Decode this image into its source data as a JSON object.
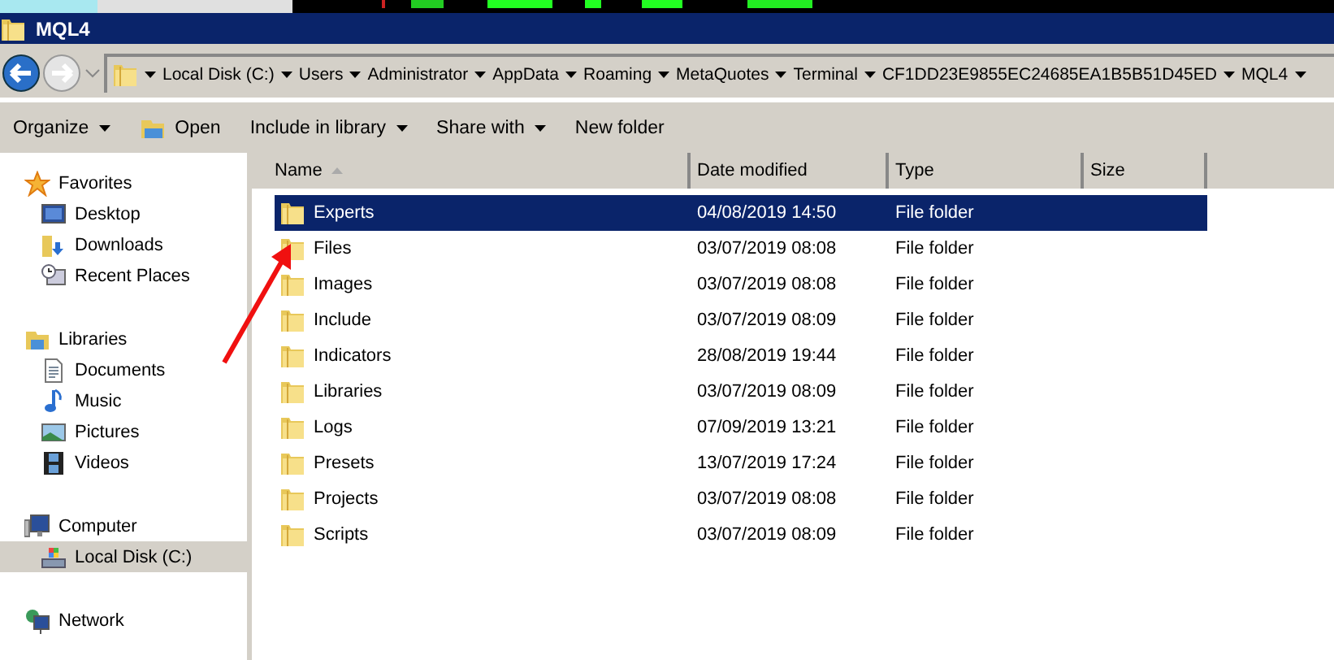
{
  "window": {
    "title": "MQL4"
  },
  "address_bar": {
    "segments": [
      "Local Disk (C:)",
      "Users",
      "Administrator",
      "AppData",
      "Roaming",
      "MetaQuotes",
      "Terminal",
      "CF1DD23E9855EC24685EA1B5B51D45ED",
      "MQL4"
    ]
  },
  "toolbar": [
    {
      "label": "Organize",
      "kind": "menu"
    },
    {
      "label": "Open",
      "kind": "icon"
    },
    {
      "label": "Include in library",
      "kind": "menu"
    },
    {
      "label": "Share with",
      "kind": "menu"
    },
    {
      "label": "New folder",
      "kind": "plain"
    }
  ],
  "sidebar": {
    "items": [
      {
        "label": "Favorites",
        "kind": "star",
        "selected": false,
        "children": [
          {
            "label": "Desktop",
            "kind": "desktop",
            "selected": false
          },
          {
            "label": "Downloads",
            "kind": "downloads",
            "selected": false
          },
          {
            "label": "Recent Places",
            "kind": "recent",
            "selected": false
          }
        ]
      },
      {
        "label": "Libraries",
        "kind": "libraries",
        "selected": false,
        "children": [
          {
            "label": "Documents",
            "kind": "document",
            "selected": false
          },
          {
            "label": "Music",
            "kind": "music",
            "selected": false
          },
          {
            "label": "Pictures",
            "kind": "pictures",
            "selected": false
          },
          {
            "label": "Videos",
            "kind": "videos",
            "selected": false
          }
        ]
      },
      {
        "label": "Computer",
        "kind": "computer",
        "selected": false,
        "children": [
          {
            "label": "Local Disk (C:)",
            "kind": "disk",
            "selected": true
          }
        ]
      },
      {
        "label": "Network",
        "kind": "network",
        "selected": false
      }
    ]
  },
  "table": {
    "columns": [
      {
        "label": "Name",
        "sorted": true
      },
      {
        "label": "Date modified",
        "sorted": false
      },
      {
        "label": "Type",
        "sorted": false
      },
      {
        "label": "Size",
        "sorted": false
      }
    ],
    "rows": [
      {
        "name": "Experts",
        "date": "04/08/2019 14:50",
        "type": "File folder",
        "selected": true
      },
      {
        "name": "Files",
        "date": "03/07/2019 08:08",
        "type": "File folder",
        "selected": false
      },
      {
        "name": "Images",
        "date": "03/07/2019 08:08",
        "type": "File folder",
        "selected": false
      },
      {
        "name": "Include",
        "date": "03/07/2019 08:09",
        "type": "File folder",
        "selected": false
      },
      {
        "name": "Indicators",
        "date": "28/08/2019 19:44",
        "type": "File folder",
        "selected": false
      },
      {
        "name": "Libraries",
        "date": "03/07/2019 08:09",
        "type": "File folder",
        "selected": false
      },
      {
        "name": "Logs",
        "date": "07/09/2019 13:21",
        "type": "File folder",
        "selected": false
      },
      {
        "name": "Presets",
        "date": "13/07/2019 17:24",
        "type": "File folder",
        "selected": false
      },
      {
        "name": "Projects",
        "date": "03/07/2019 08:08",
        "type": "File folder",
        "selected": false
      },
      {
        "name": "Scripts",
        "date": "03/07/2019 08:09",
        "type": "File folder",
        "selected": false
      }
    ]
  }
}
